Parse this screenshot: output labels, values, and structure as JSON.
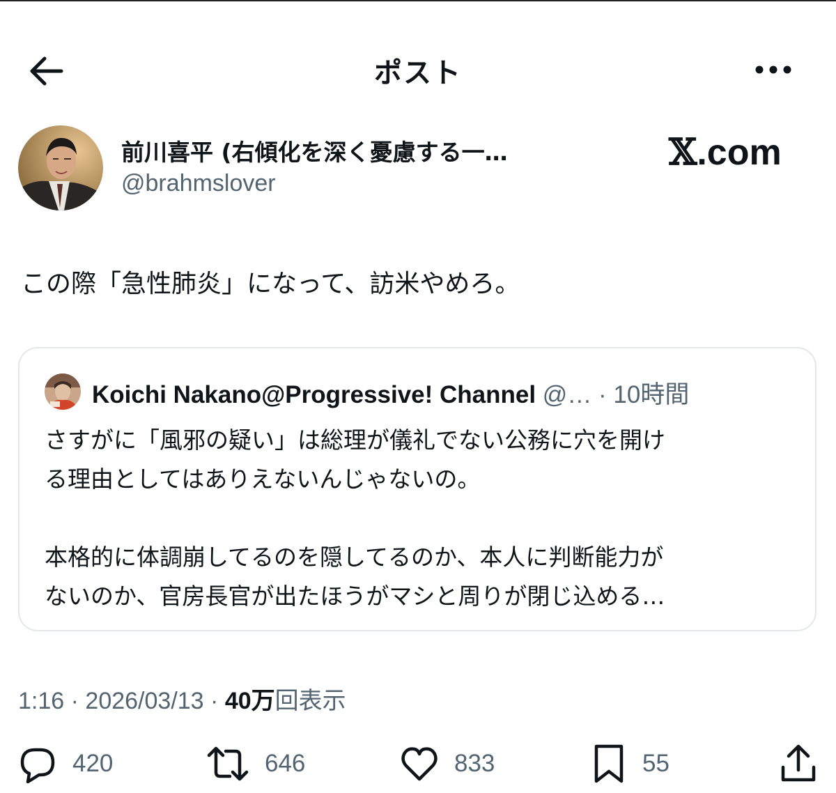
{
  "header": {
    "title": "ポスト"
  },
  "post": {
    "display_name": "前川喜平 (右傾化を深く憂慮する一…",
    "handle": "@brahmslover",
    "brand": ".com",
    "text": "この際「急性肺炎」になって、訪米やめろ。"
  },
  "quote": {
    "name": "Koichi Nakano@Progressive! Channel",
    "meta": " @… · 10時間",
    "para1_line1": "さすがに「風邪の疑い」は総理が儀礼でない公務に穴を開け",
    "para1_line2": "る理由としてはありえないんじゃないの。",
    "para2_line1": "本格的に体調崩してるのを隠してるのか、本人に判断能力が",
    "para2_line2": "ないのか、官房長官が出たほうがマシと周りが閉じ込める…"
  },
  "meta": {
    "time": "1:16",
    "date": "2026/03/13",
    "views_count": "40万",
    "views_label": "回表示"
  },
  "actions": {
    "replies": "420",
    "reposts": "646",
    "likes": "833",
    "bookmarks": "55"
  },
  "icons": {
    "back": "arrow-left-icon",
    "more": "more-horizontal-icon",
    "reply": "reply-bubble-icon",
    "repost": "repost-icon",
    "like": "heart-icon",
    "bookmark": "bookmark-icon",
    "share": "share-icon"
  }
}
